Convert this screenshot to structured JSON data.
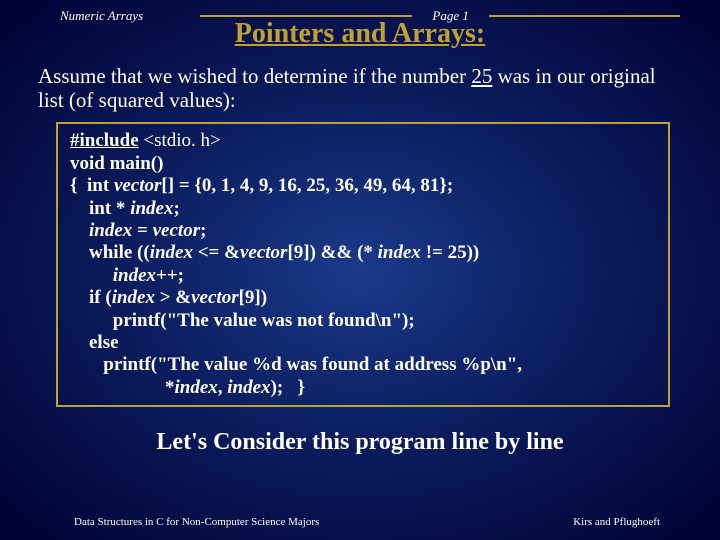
{
  "header": {
    "left": "Numeric Arrays",
    "page": "Page 1"
  },
  "title": "Pointers and Arrays:",
  "intro": {
    "before_num": "Assume that we wished to determine if the number ",
    "num": "25",
    "after_num": " was in our original list (of squared values):"
  },
  "code": {
    "l1a": "#include",
    "l1b": " <stdio. h>",
    "l2a": "void main",
    "l2b": "()",
    "l3a": "{  ",
    "l3b": "int ",
    "l3c": "vector",
    "l3d": "[] = {0, 1, 4, 9, 16, 25, 36, 49, 64, 81};",
    "l4a": "    int * ",
    "l4b": "index",
    "l4c": ";",
    "l5a": "    ",
    "l5b": "index",
    "l5c": " = ",
    "l5d": "vector",
    "l5e": ";",
    "l6a": "    while ((",
    "l6b": "index",
    "l6c": " <= &",
    "l6d": "vector",
    "l6e": "[9]) && (* ",
    "l6f": "index",
    "l6g": " != 25))",
    "l7a": "         ",
    "l7b": "index",
    "l7c": "++;",
    "l8a": "    if (",
    "l8b": "index",
    "l8c": " > &",
    "l8d": "vector",
    "l8e": "[9])",
    "l9a": "         printf(\"",
    "l9b": "The value was not found",
    "l9c": "\\n\");",
    "l10": "    else",
    "l11a": "       printf(\"",
    "l11b": "The value %d was found at address ",
    "l11c": "%p\\n\",",
    "l12a": "                    *",
    "l12b": "index",
    "l12c": ", ",
    "l12d": "index",
    "l12e": ");   }"
  },
  "subtitle": "Let's Consider this program line by line",
  "footer": {
    "left": "Data Structures in C for Non-Computer Science Majors",
    "right": "Kirs and Pflughoeft"
  }
}
